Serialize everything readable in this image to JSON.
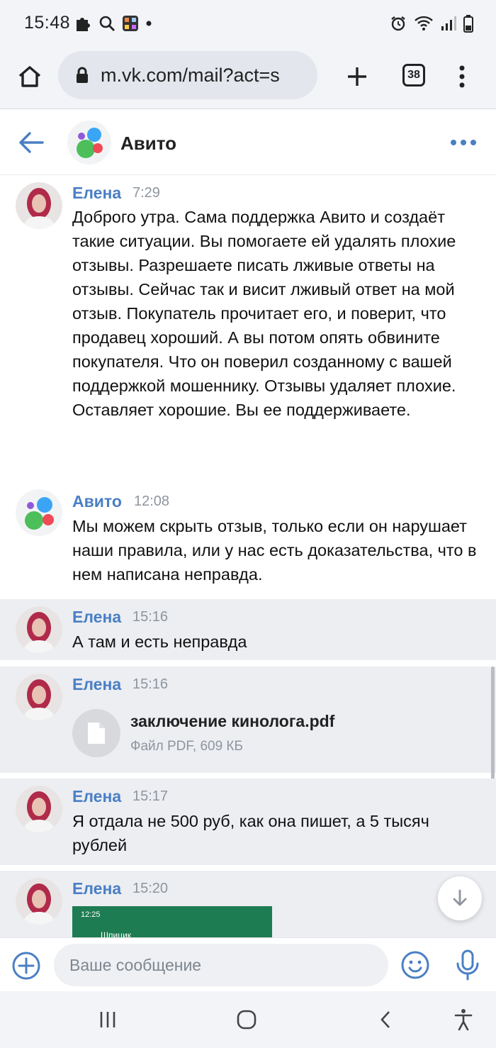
{
  "status_bar": {
    "time": "15:48",
    "icons_left": [
      "puzzle-icon",
      "search-icon",
      "app-grid-icon",
      "dot-icon"
    ],
    "icons_right": [
      "alarm-icon",
      "wifi-icon",
      "signal-icon",
      "battery-icon"
    ]
  },
  "browser": {
    "url": "m.vk.com/mail?act=s",
    "tab_count": "38"
  },
  "chat": {
    "title": "Авито"
  },
  "messages": [
    {
      "author": "Елена",
      "time": "7:29",
      "text": "Доброго утра. Сама поддержка Авито и создаёт такие ситуации. Вы помогаете ей удалять плохие отзывы. Разрешаете писать лживые ответы на отзывы. Сейчас так и висит лживый ответ на мой отзыв. Покупатель прочитает его, и поверит, что продавец хороший. А вы потом опять обвините покупателя. Что он поверил созданному с вашей поддержкой мошеннику. Отзывы удаляет плохие. Оставляет хорошие. Вы ее поддерживаете."
    },
    {
      "author": "Авито",
      "time": "12:08",
      "text": "Мы можем скрыть отзыв, только если он нарушает наши правила, или у нас есть доказательства, что в нем написана неправда."
    },
    {
      "author": "Елена",
      "time": "15:16",
      "text": "А там и есть неправда"
    },
    {
      "author": "Елена",
      "time": "15:16",
      "attachment": {
        "name": "заключение кинолога.pdf",
        "meta": "Файл PDF, 609 КБ"
      }
    },
    {
      "author": "Елена",
      "time": "15:17",
      "text": "Я отдала не 500 руб, как она пишет, а 5 тысяч рублей"
    },
    {
      "author": "Елена",
      "time": "15:20",
      "image": {
        "time": "12:25",
        "name": "Шпицик"
      }
    }
  ],
  "composer": {
    "placeholder": "Ваше сообщение"
  },
  "colors": {
    "accent": "#4a7fc4",
    "avito_green": "#4cbf5a",
    "avito_blue": "#3ba5f5",
    "avito_red": "#ef4a55",
    "avito_purple": "#8f5ad8"
  }
}
